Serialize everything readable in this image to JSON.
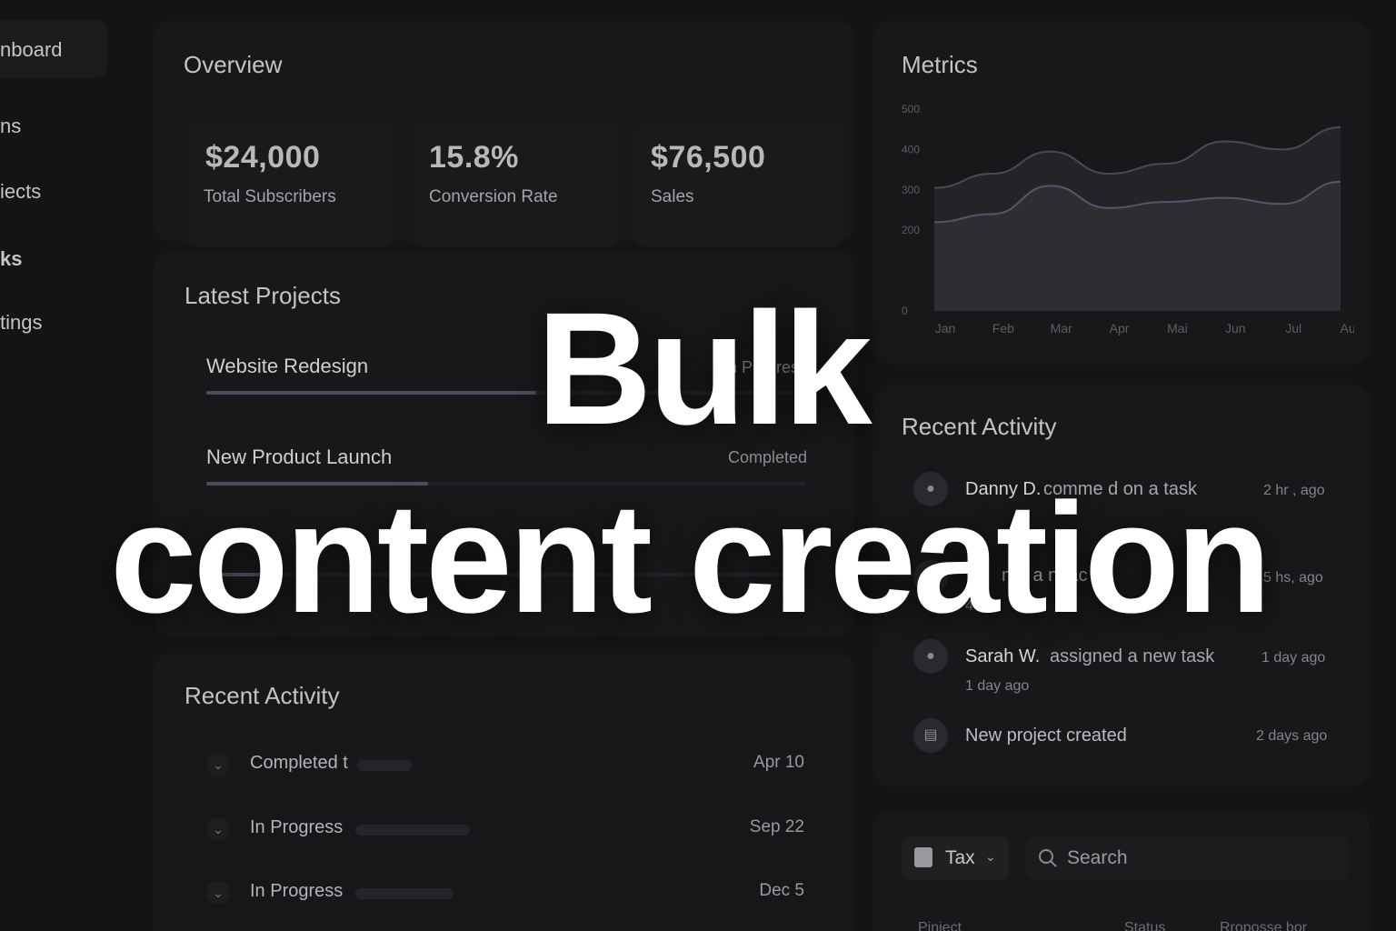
{
  "sidebar": {
    "items": [
      {
        "label": "nboard"
      },
      {
        "label": "ns"
      },
      {
        "label": "iects"
      },
      {
        "label": "ks"
      },
      {
        "label": "tings"
      }
    ]
  },
  "overview": {
    "title": "Overview",
    "stats": [
      {
        "value": "$24,000",
        "label": "Total Subscribers"
      },
      {
        "value": "15.8%",
        "label": "Conversion Rate"
      },
      {
        "value": "$76,500",
        "label": "Sales"
      }
    ]
  },
  "latest_projects": {
    "title": "Latest Projects",
    "items": [
      {
        "name": "Website Redesign",
        "status": "In Progress",
        "progress": 0.55
      },
      {
        "name": "New Product Launch",
        "status": "Completed",
        "progress": 0.37
      },
      {
        "name": "",
        "status": "",
        "progress": 0.1
      }
    ]
  },
  "recent_activity_left": {
    "title": "Recent Activity",
    "rows": [
      {
        "label": "Completed t",
        "date": "Apr 10"
      },
      {
        "label": "In Progress",
        "date": "Sep 22"
      },
      {
        "label": "In Progress",
        "date": "Dec 5"
      }
    ]
  },
  "metrics": {
    "title": "Metrics"
  },
  "chart_data": {
    "type": "area",
    "title": "Metrics",
    "categories": [
      "Jan",
      "Feb",
      "Mar",
      "Apr",
      "Mai",
      "Jun",
      "Jul",
      "Aug"
    ],
    "yticks": [
      "500",
      "400",
      "300",
      "200",
      "0"
    ],
    "ylim": [
      0,
      500
    ],
    "grid": false,
    "series": [
      {
        "values": [
          305,
          340,
          395,
          340,
          365,
          420,
          400,
          455
        ]
      },
      {
        "values": [
          220,
          240,
          310,
          255,
          270,
          280,
          265,
          320
        ]
      }
    ]
  },
  "recent_activity_right": {
    "title": "Recent Activity",
    "items": [
      {
        "avatar": "person-icon",
        "name": "Danny D.",
        "action": "comme   d on a task",
        "sub": "",
        "time": "2 hr , ago"
      },
      {
        "avatar": "person-icon",
        "name": "Ye",
        "action": "nor    a    n tac",
        "sub": "4 d",
        "time": "5 hs, ago"
      },
      {
        "avatar": "person-icon",
        "name": "Sarah W.",
        "action": "assigned a new task",
        "sub": "1 day ago",
        "time": "1 day ago"
      },
      {
        "avatar": "document-icon",
        "name": "",
        "action": "New project created",
        "sub": "",
        "time": "2 days ago"
      }
    ]
  },
  "toolbar": {
    "tax_label": "Tax",
    "search_placeholder": "Search",
    "columns": [
      "Piniect",
      "Status",
      "Rroposse bor"
    ]
  },
  "overlay": {
    "line1": "Bulk",
    "line2": "content creation"
  }
}
